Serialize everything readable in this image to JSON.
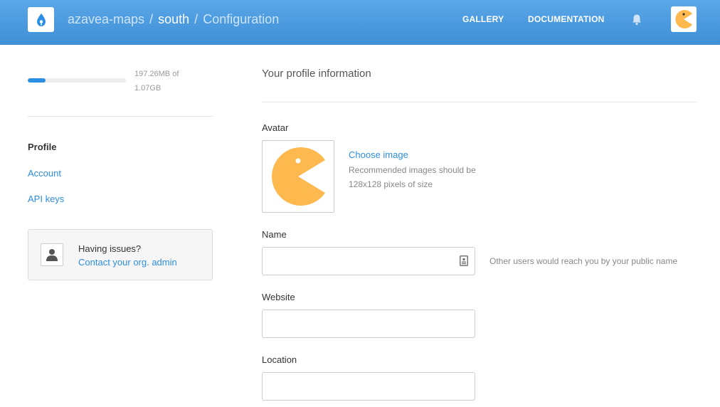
{
  "header": {
    "logo_icon": "carto-droplet-icon",
    "breadcrumb": {
      "user": "azavea-maps",
      "separator": "/",
      "org": "south",
      "page": "Configuration"
    },
    "nav": {
      "gallery": "GALLERY",
      "documentation": "DOCUMENTATION"
    },
    "notification_icon": "bell-icon",
    "avatar_icon": "pacman-avatar-icon",
    "gradient_top": "#5aa7e8",
    "gradient_bottom": "#3f8fd6"
  },
  "sidebar": {
    "usage": {
      "fraction": 0.18,
      "text_line1": "197.26MB of",
      "text_line2": "1.07GB",
      "fill_color": "#2a8ee3"
    },
    "items": [
      {
        "label": "Profile",
        "active": true
      },
      {
        "label": "Account",
        "active": false
      },
      {
        "label": "API keys",
        "active": false
      }
    ],
    "help": {
      "icon": "user-silhouette-icon",
      "title": "Having issues?",
      "link": "Contact your org. admin"
    }
  },
  "main": {
    "title": "Your profile information",
    "avatar": {
      "label": "Avatar",
      "image_icon": "pacman-avatar-icon",
      "choose_label": "Choose image",
      "hint_line1": "Recommended images should be",
      "hint_line2": "128x128 pixels of size",
      "avatar_color": "#fdb94e"
    },
    "fields": {
      "name": {
        "label": "Name",
        "value": "",
        "placeholder": "",
        "hint": "Other users would reach you by your public name"
      },
      "website": {
        "label": "Website",
        "value": "",
        "placeholder": ""
      },
      "location": {
        "label": "Location",
        "value": "",
        "placeholder": ""
      }
    },
    "link_color": "#2e8ee0"
  }
}
